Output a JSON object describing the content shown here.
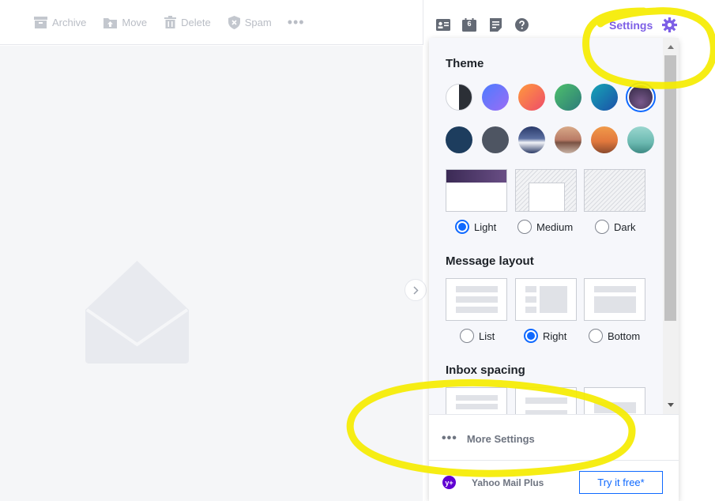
{
  "toolbar": {
    "archive": "Archive",
    "move": "Move",
    "delete": "Delete",
    "spam": "Spam",
    "more": "•••"
  },
  "header": {
    "calendar_day": "6",
    "settings_label": "Settings"
  },
  "panel": {
    "theme_title": "Theme",
    "theme_options": [
      "Light",
      "Medium",
      "Dark"
    ],
    "theme_selected": "Light",
    "layout_title": "Message layout",
    "layout_options": [
      "List",
      "Right",
      "Bottom"
    ],
    "layout_selected": "Right",
    "spacing_title": "Inbox spacing",
    "more_settings": "More Settings",
    "more_dots": "•••",
    "plus_badge": "y+",
    "plus_label": "Yahoo Mail Plus",
    "try_button": "Try it free*"
  },
  "colors": {
    "accent": "#7d5fe6",
    "radio_selected": "#0f69ff",
    "yahoo_purple": "#6001d2",
    "highlighter": "#f5ec00"
  },
  "icons": {
    "archive": "archive-icon",
    "move": "folder-move-icon",
    "delete": "trash-icon",
    "spam": "shield-icon",
    "contacts": "contacts-icon",
    "calendar": "calendar-icon",
    "notepad": "notepad-icon",
    "help": "help-icon",
    "settings": "gear-icon"
  }
}
